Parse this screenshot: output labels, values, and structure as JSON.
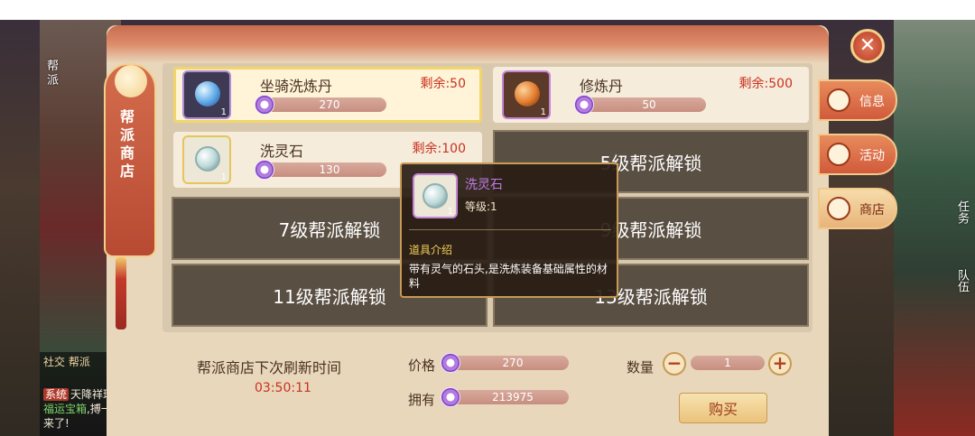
{
  "shop": {
    "title_vertical": "帮派商店",
    "items": [
      {
        "name": "坐骑洗炼丹",
        "remain": "剩余:50",
        "price": "270",
        "qty_mark": "1"
      },
      {
        "name": "修炼丹",
        "remain": "剩余:500",
        "price": "50",
        "qty_mark": "1"
      },
      {
        "name": "洗灵石",
        "remain": "剩余:100",
        "price": "130",
        "qty_mark": "1"
      }
    ],
    "locked": [
      "5级帮派解锁",
      "7级帮派解锁",
      "9级帮派解锁",
      "11级帮派解锁",
      "13级帮派解锁"
    ]
  },
  "tooltip": {
    "name": "洗灵石",
    "level": "等级:1",
    "qty_mark": "1",
    "section": "道具介绍",
    "desc": "带有灵气的石头,是洗炼装备基础属性的材料"
  },
  "footer": {
    "refresh_label": "帮派商店下次刷新时间",
    "refresh_time": "03:50:11",
    "price_label": "价格",
    "price_value": "270",
    "own_label": "拥有",
    "own_value": "213975",
    "qty_label": "数量",
    "qty_value": "1",
    "minus": "−",
    "plus": "+",
    "buy": "购买"
  },
  "tabs": [
    "信息",
    "活动",
    "商店"
  ],
  "close": "✕",
  "background": {
    "left_top": "帮派",
    "chat_tabs": "社交  帮派",
    "chat_sys": "系统",
    "chat_line1": "天降祥瑞,也",
    "chat_line2_green": "福运宝箱",
    "chat_line2": ",搏一搏",
    "chat_line3": "来了!",
    "right_task": "任务",
    "right_team": "队伍"
  }
}
